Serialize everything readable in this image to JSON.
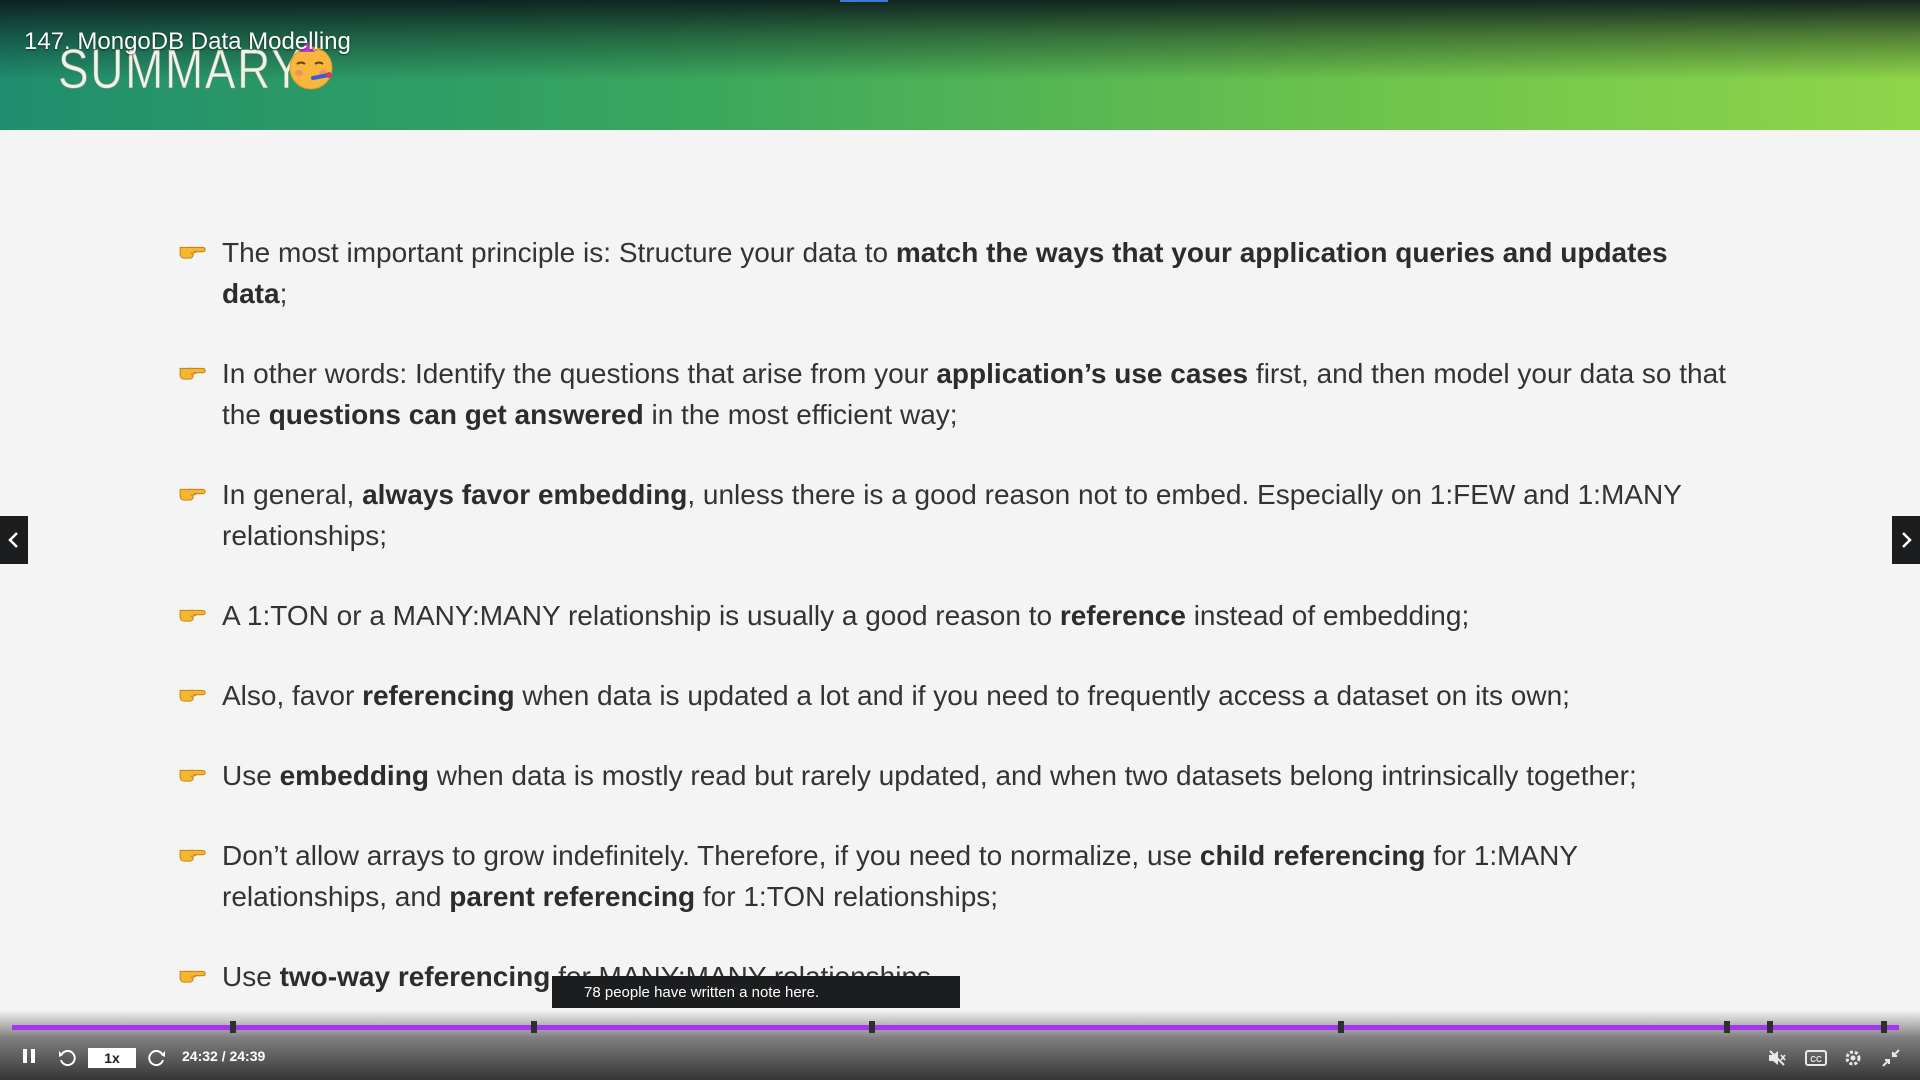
{
  "video": {
    "title": "147. MongoDB Data Modelling",
    "notes_tooltip": "78 people have written a note here."
  },
  "slide": {
    "heading": "SUMMARY",
    "emoji_icon": "party-face-icon",
    "accent_colors": [
      "#1f8e6e",
      "#8fd64a"
    ],
    "bullets": [
      {
        "parts": [
          "The most important principle is: Structure your data to ",
          "match the ways that your application queries and updates data",
          ";"
        ]
      },
      {
        "parts": [
          "In other words: Identify the questions that arise from your ",
          "application’s use cases",
          " first, and then model your data so that the ",
          "questions can get answered",
          " in the most efficient way;"
        ]
      },
      {
        "parts": [
          "In general, ",
          "always favor embedding",
          ", unless there is a good reason not to embed. Especially on 1:FEW and 1:MANY relationships;"
        ]
      },
      {
        "parts": [
          "A 1:TON or a MANY:MANY relationship is usually a good reason to ",
          "reference",
          " instead of embedding;"
        ]
      },
      {
        "parts": [
          "Also, favor ",
          "referencing",
          " when data is updated a lot and if you need to frequently access a dataset on its own;"
        ]
      },
      {
        "parts": [
          "Use ",
          "embedding",
          " when data is mostly read but rarely updated, and when two datasets belong intrinsically together;"
        ]
      },
      {
        "parts": [
          "Don’t allow arrays to grow indefinitely. Therefore, if you need to normalize, use ",
          "child referencing",
          " for 1:MANY relationships, and ",
          "parent referencing",
          " for 1:TON relationships;"
        ]
      },
      {
        "parts": [
          "Use ",
          "two-way referencing",
          " for MANY:MANY relationships."
        ]
      }
    ]
  },
  "player": {
    "speed": "1x",
    "time": "24:32 / 24:39",
    "progress_fraction": 0.995,
    "progress_color": "#a435f0",
    "marker_fractions": [
      0.094,
      0.224,
      0.37,
      0.576,
      0.742,
      0.761,
      0.81
    ],
    "icons": {
      "pause": "pause-icon",
      "rewind": "rewind-icon",
      "forward": "forward-icon",
      "volume": "volume-muted-icon",
      "captions": "captions-icon",
      "settings": "settings-icon",
      "fullscreen": "exit-fullscreen-icon",
      "prev": "chevron-left-icon",
      "next": "chevron-right-icon"
    }
  }
}
